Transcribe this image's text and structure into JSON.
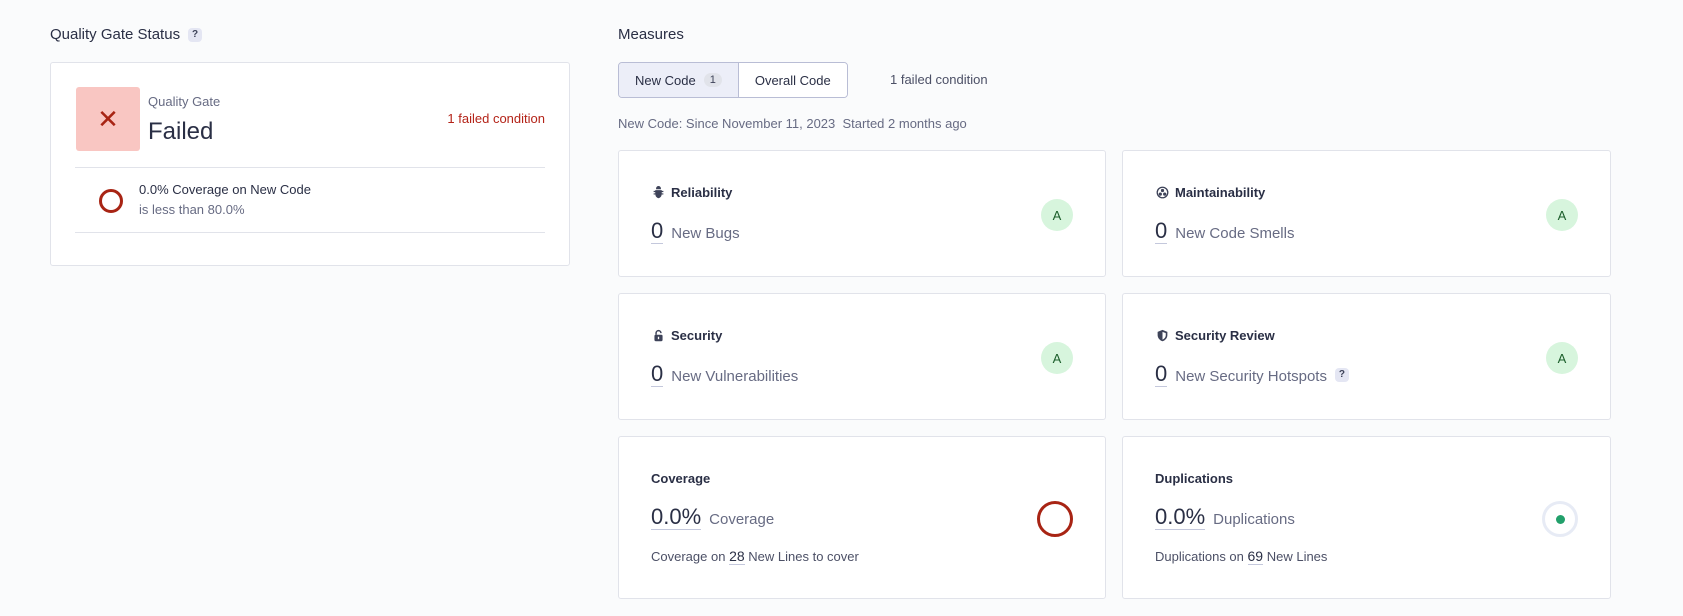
{
  "quality_gate": {
    "section_title": "Quality Gate Status",
    "help": "?",
    "badge_icon": "✕",
    "small_label": "Quality Gate",
    "status": "Failed",
    "failed_summary": "1 failed condition",
    "condition": {
      "title": "0.0% Coverage on New Code",
      "subtitle": "is less than 80.0%"
    }
  },
  "measures": {
    "section_title": "Measures",
    "tabs": [
      {
        "label": "New Code",
        "count": "1",
        "active": true
      },
      {
        "label": "Overall Code",
        "active": false
      }
    ],
    "failed_summary": "1 failed condition",
    "new_code_info": "New Code: Since November 11, 2023  Started 2 months ago",
    "cards": {
      "reliability": {
        "title": "Reliability",
        "icon": "bug-icon",
        "value": "0",
        "label": "New Bugs",
        "rating": "A"
      },
      "maintainability": {
        "title": "Maintainability",
        "icon": "maintainability-icon",
        "value": "0",
        "label": "New Code Smells",
        "rating": "A"
      },
      "security": {
        "title": "Security",
        "icon": "lock-icon",
        "value": "0",
        "label": "New Vulnerabilities",
        "rating": "A"
      },
      "security_review": {
        "title": "Security Review",
        "icon": "shield-icon",
        "value": "0",
        "label": "New Security Hotspots",
        "help": "?",
        "rating": "A"
      },
      "coverage": {
        "title": "Coverage",
        "value": "0.0%",
        "label": "Coverage",
        "sub_prefix": "Coverage on",
        "sub_value": "28",
        "sub_suffix": "New Lines to cover"
      },
      "duplications": {
        "title": "Duplications",
        "value": "0.0%",
        "label": "Duplications",
        "sub_prefix": "Duplications on",
        "sub_value": "69",
        "sub_suffix": "New Lines"
      }
    }
  },
  "colors": {
    "failed": "#b42318",
    "rating_bg": "#d7f5dd",
    "coverage_ring": "#a82414",
    "duplication_dot": "#22a06b"
  }
}
